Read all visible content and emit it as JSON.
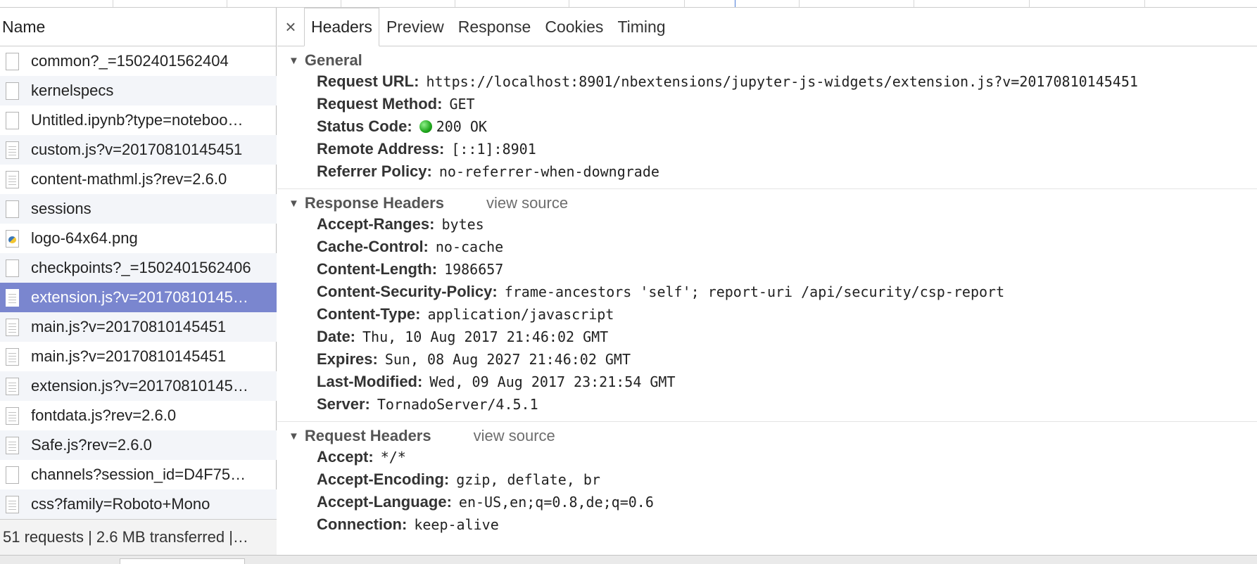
{
  "name_header": "Name",
  "requests": [
    {
      "name": "common?_=1502401562404",
      "icon": "document-icon"
    },
    {
      "name": "kernelspecs",
      "icon": "document-icon"
    },
    {
      "name": "Untitled.ipynb?type=noteboo…",
      "icon": "document-icon"
    },
    {
      "name": "custom.js?v=20170810145451",
      "icon": "script-file-icon"
    },
    {
      "name": "content-mathml.js?rev=2.6.0",
      "icon": "script-file-icon"
    },
    {
      "name": "sessions",
      "icon": "document-icon"
    },
    {
      "name": "logo-64x64.png",
      "icon": "image-file-icon"
    },
    {
      "name": "checkpoints?_=1502401562406",
      "icon": "document-icon"
    },
    {
      "name": "extension.js?v=20170810145…",
      "icon": "script-file-icon",
      "selected": true
    },
    {
      "name": "main.js?v=20170810145451",
      "icon": "script-file-icon"
    },
    {
      "name": "main.js?v=20170810145451",
      "icon": "script-file-icon"
    },
    {
      "name": "extension.js?v=20170810145…",
      "icon": "script-file-icon"
    },
    {
      "name": "fontdata.js?rev=2.6.0",
      "icon": "script-file-icon"
    },
    {
      "name": "Safe.js?rev=2.6.0",
      "icon": "script-file-icon"
    },
    {
      "name": "channels?session_id=D4F75…",
      "icon": "document-icon"
    },
    {
      "name": "css?family=Roboto+Mono",
      "icon": "script-file-icon"
    }
  ],
  "status_bar": "51 requests | 2.6 MB transferred |…",
  "close_glyph": "×",
  "tabs": [
    "Headers",
    "Preview",
    "Response",
    "Cookies",
    "Timing"
  ],
  "active_tab": "Headers",
  "view_source_label": "view source",
  "general": {
    "title": "General",
    "rows": [
      {
        "key": "Request URL:",
        "value": "https://localhost:8901/nbextensions/jupyter-js-widgets/extension.js?v=20170810145451"
      },
      {
        "key": "Request Method:",
        "value": "GET"
      },
      {
        "key": "Status Code:",
        "value": "200 OK",
        "status_color": "#1fa51c"
      },
      {
        "key": "Remote Address:",
        "value": "[::1]:8901"
      },
      {
        "key": "Referrer Policy:",
        "value": "no-referrer-when-downgrade"
      }
    ]
  },
  "response_headers": {
    "title": "Response Headers",
    "rows": [
      {
        "key": "Accept-Ranges:",
        "value": "bytes"
      },
      {
        "key": "Cache-Control:",
        "value": "no-cache"
      },
      {
        "key": "Content-Length:",
        "value": "1986657"
      },
      {
        "key": "Content-Security-Policy:",
        "value": "frame-ancestors 'self'; report-uri /api/security/csp-report"
      },
      {
        "key": "Content-Type:",
        "value": "application/javascript"
      },
      {
        "key": "Date:",
        "value": "Thu, 10 Aug 2017 21:46:02 GMT"
      },
      {
        "key": "Expires:",
        "value": "Sun, 08 Aug 2027 21:46:02 GMT"
      },
      {
        "key": "Last-Modified:",
        "value": "Wed, 09 Aug 2017 23:21:54 GMT"
      },
      {
        "key": "Server:",
        "value": "TornadoServer/4.5.1"
      }
    ]
  },
  "request_headers": {
    "title": "Request Headers",
    "rows": [
      {
        "key": "Accept:",
        "value": "*/*"
      },
      {
        "key": "Accept-Encoding:",
        "value": "gzip, deflate, br"
      },
      {
        "key": "Accept-Language:",
        "value": "en-US,en;q=0.8,de;q=0.6"
      },
      {
        "key": "Connection:",
        "value": "keep-alive"
      }
    ]
  },
  "colors": {
    "selected_row": "#7a86cf",
    "alt_row": "#f3f5f9"
  }
}
